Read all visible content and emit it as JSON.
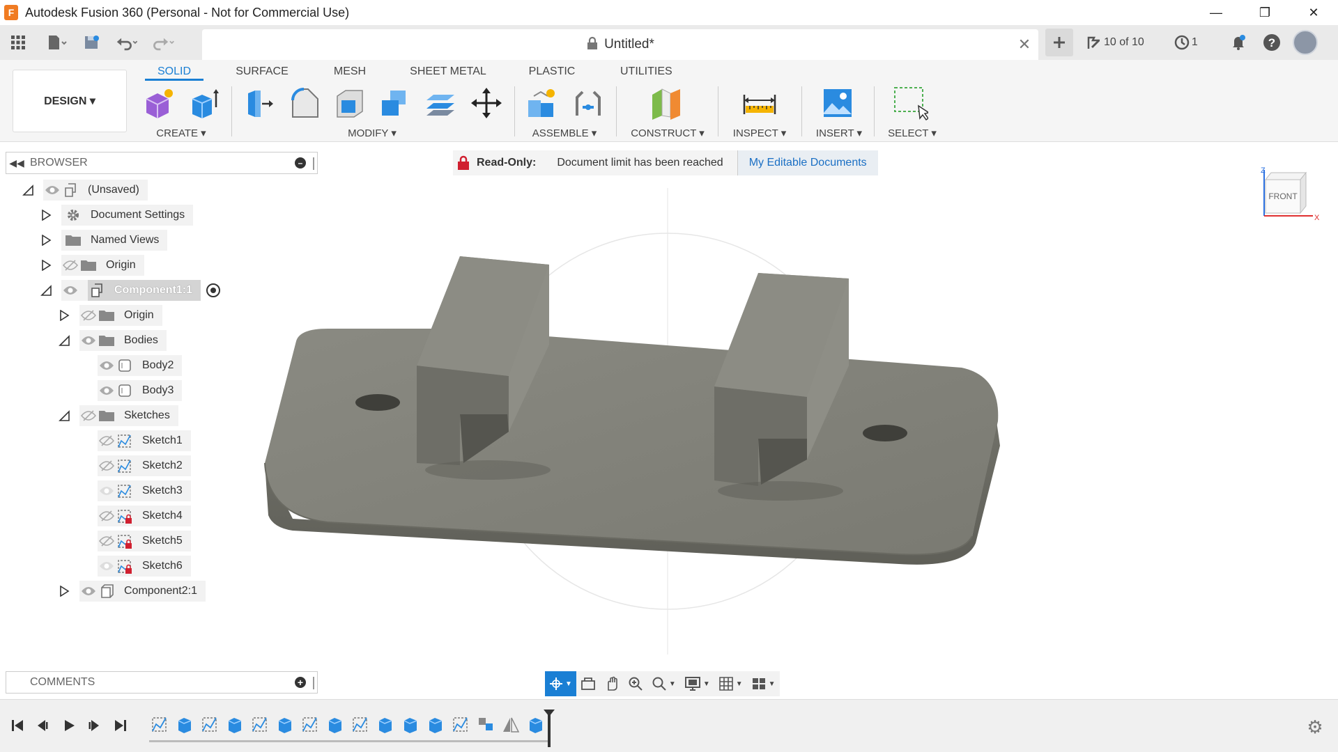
{
  "window": {
    "title": "Autodesk Fusion 360 (Personal - Not for Commercial Use)",
    "logo": "F",
    "minimize": "—",
    "restore": "❐",
    "close": "✕"
  },
  "doc_tab": {
    "title": "Untitled*",
    "close": "✕"
  },
  "quick_access": {
    "jobs": "10 of 10",
    "history_count": "1"
  },
  "ribbon": {
    "workspace": "DESIGN ▾",
    "tabs": [
      "SOLID",
      "SURFACE",
      "MESH",
      "SHEET METAL",
      "PLASTIC",
      "UTILITIES"
    ],
    "groups": [
      "CREATE ▾",
      "MODIFY ▾",
      "ASSEMBLE ▾",
      "CONSTRUCT ▾",
      "INSPECT ▾",
      "INSERT ▾",
      "SELECT ▾"
    ]
  },
  "browser": {
    "title": "BROWSER",
    "items": [
      {
        "label": "(Unsaved)"
      },
      {
        "label": "Document Settings"
      },
      {
        "label": "Named Views"
      },
      {
        "label": "Origin"
      },
      {
        "label": "Component1:1"
      },
      {
        "label": "Origin"
      },
      {
        "label": "Bodies"
      },
      {
        "label": "Body2"
      },
      {
        "label": "Body3"
      },
      {
        "label": "Sketches"
      },
      {
        "label": "Sketch1"
      },
      {
        "label": "Sketch2"
      },
      {
        "label": "Sketch3"
      },
      {
        "label": "Sketch4"
      },
      {
        "label": "Sketch5"
      },
      {
        "label": "Sketch6"
      },
      {
        "label": "Component2:1"
      }
    ]
  },
  "banner": {
    "label": "Read-Only:",
    "message": "Document limit has been reached",
    "link": "My Editable Documents"
  },
  "viewcube": {
    "face": "FRONT",
    "z": "Z",
    "x": "X"
  },
  "comments": {
    "title": "COMMENTS"
  },
  "colors": {
    "accent": "#1a7fd4",
    "model": "#7a7a72",
    "readonly_red": "#d02030"
  }
}
